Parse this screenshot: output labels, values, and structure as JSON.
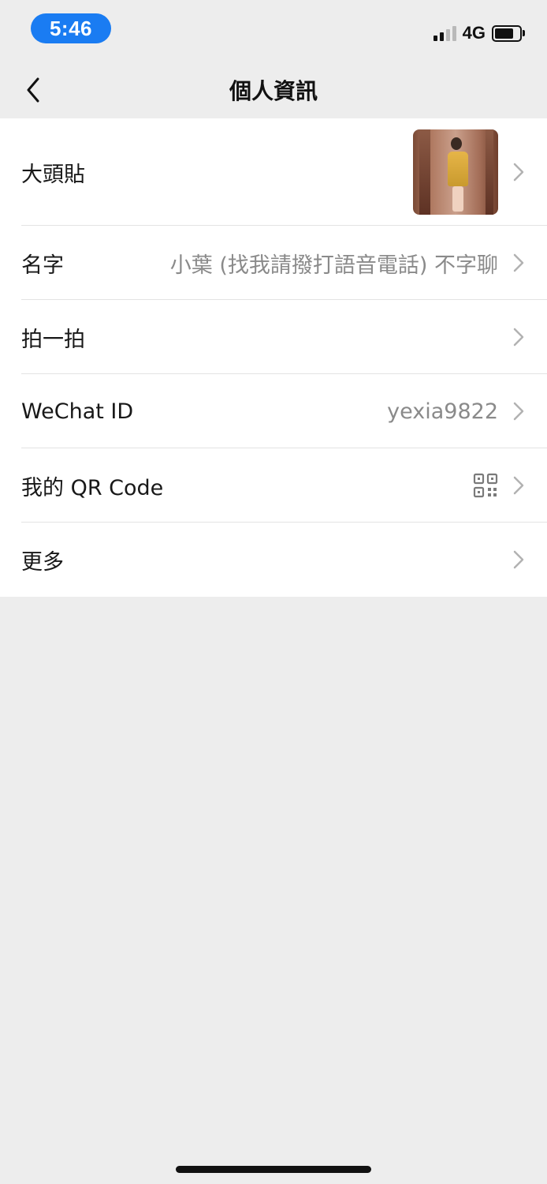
{
  "status_bar": {
    "time": "5:46",
    "network": "4G",
    "signal_bars_active": 2,
    "signal_bars_total": 4,
    "battery_level": 0.75,
    "time_pill_color": "#1a7cf2"
  },
  "nav": {
    "title": "個人資訊",
    "back_icon": "chevron-left-icon"
  },
  "profile": {
    "avatar": {
      "label": "大頭貼"
    },
    "name": {
      "label": "名字",
      "value": "小葉 (找我請撥打語音電話) 不字聊"
    },
    "pat": {
      "label": "拍一拍"
    },
    "wechat_id": {
      "label": "WeChat ID",
      "value": "yexia9822"
    },
    "qr_code": {
      "label": "我的 QR Code",
      "icon": "qr-code-icon"
    },
    "more": {
      "label": "更多"
    }
  },
  "colors": {
    "background": "#ededed",
    "list_background": "#ffffff",
    "value_text": "#8a8a8a",
    "chevron": "#b2b2b2"
  }
}
